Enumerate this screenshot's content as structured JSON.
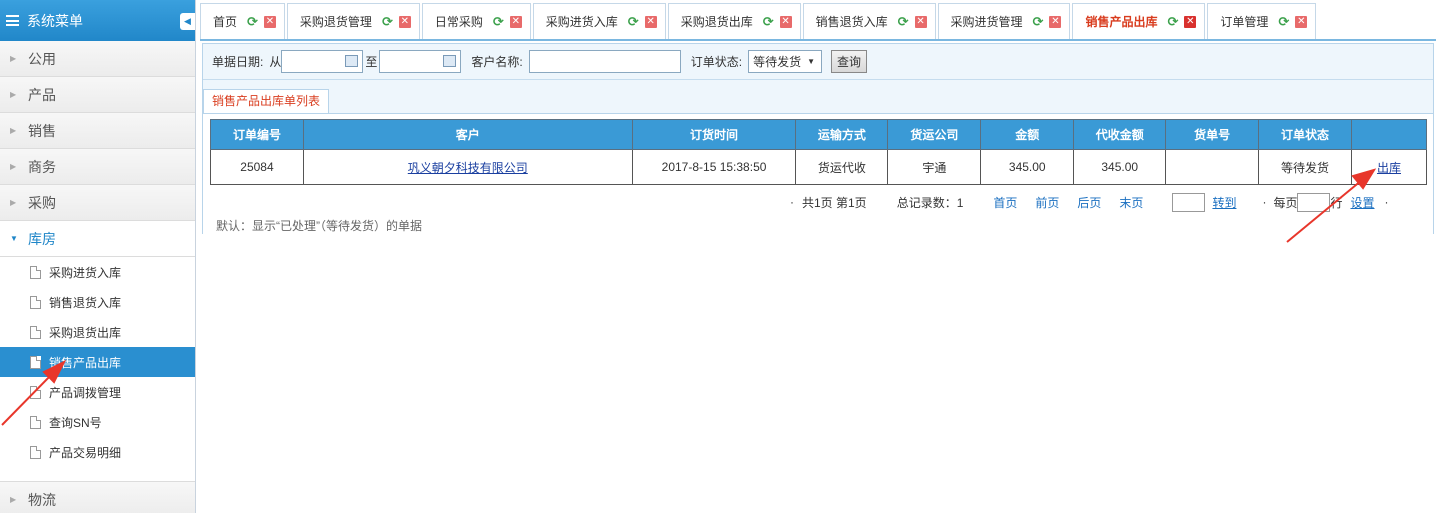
{
  "sidebar": {
    "title": "系统菜单",
    "groups": [
      "公用",
      "产品",
      "销售",
      "商务",
      "采购"
    ],
    "open_group": "库房",
    "items": [
      "采购进货入库",
      "销售退货入库",
      "采购退货出库",
      "销售产品出库",
      "产品调拨管理",
      "查询SN号",
      "产品交易明细"
    ],
    "bottom_group": "物流"
  },
  "tabs": [
    "首页",
    "采购退货管理",
    "日常采购",
    "采购进货入库",
    "采购退货出库",
    "销售退货入库",
    "采购进货管理",
    "销售产品出库",
    "订单管理"
  ],
  "filter": {
    "date_label": "单据日期:",
    "from": "从",
    "to": "至",
    "customer_label": "客户名称:",
    "status_label": "订单状态:",
    "status_value": "等待发货",
    "query_button": "查询"
  },
  "list_title": "销售产品出库单列表",
  "table": {
    "headers": [
      "订单编号",
      "客户",
      "订货时间",
      "运输方式",
      "货运公司",
      "金额",
      "代收金额",
      "货单号",
      "订单状态",
      ""
    ],
    "row": {
      "id": "25084",
      "customer": "巩义朝夕科技有限公司",
      "time": "2017-8-15 15:38:50",
      "shipping": "货运代收",
      "carrier": "宇通",
      "amount": "345.00",
      "cod": "345.00",
      "waybill": "",
      "status": "等待发货",
      "action": "出库"
    }
  },
  "pager": {
    "pages": "共1页 第1页",
    "total": "总记录数：1",
    "first": "首页",
    "prev": "前页",
    "next": "后页",
    "last": "末页",
    "goto": "转到",
    "per_page_pre": "每页",
    "per_page_post": "行",
    "settings": "设置"
  },
  "note": "默认：显示“已处理”（等待发货）的单据",
  "colors": {
    "accent": "#2a8fd0",
    "active_tab": "#d93d1f",
    "arrow": "#e8362b"
  }
}
